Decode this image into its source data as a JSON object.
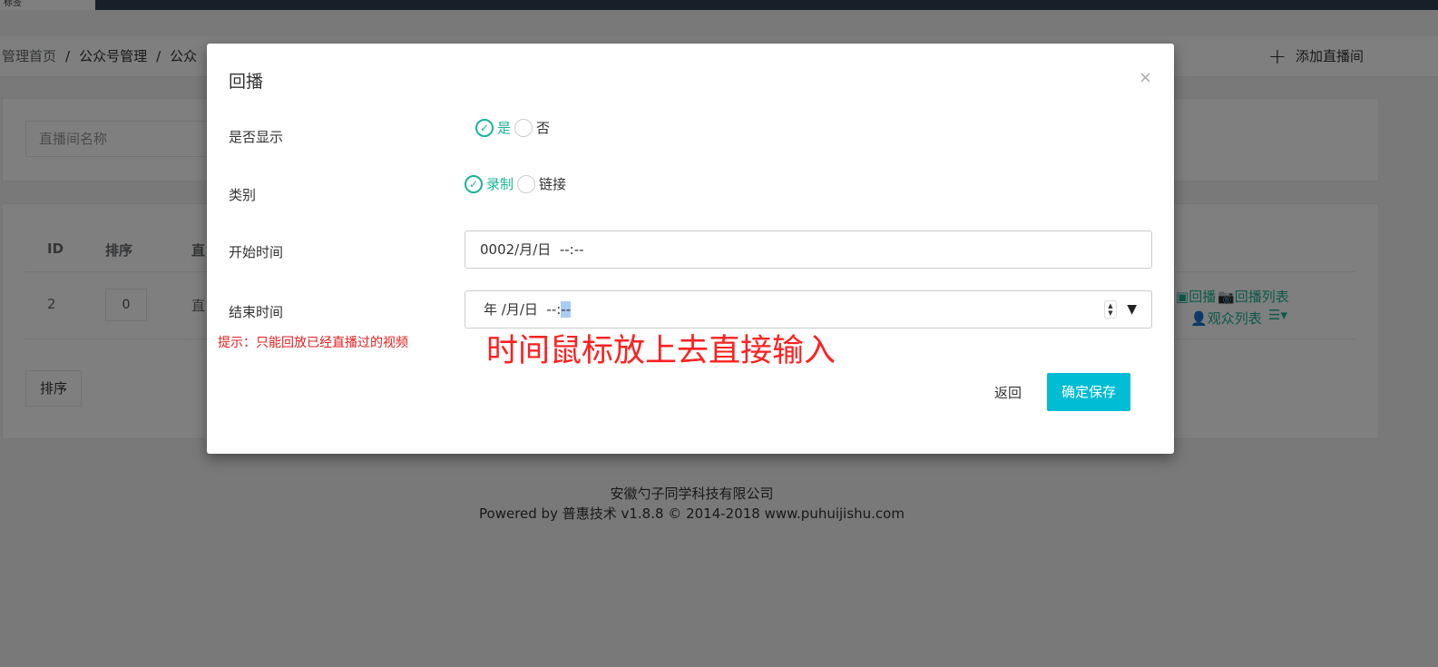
{
  "topbar": {
    "tab_label": "标签"
  },
  "breadcrumb": {
    "items": [
      "管理首页",
      "公众号管理",
      "公众"
    ]
  },
  "header": {
    "add_button_label": "添加直播间",
    "add_icon": "plus-icon"
  },
  "search": {
    "placeholder": "直播间名称"
  },
  "table": {
    "headers": [
      "ID",
      "排序",
      "直"
    ],
    "rows": [
      {
        "id": "2",
        "sort": "0",
        "name": "直",
        "actions": [
          "回播",
          "回播列表",
          "观众列表"
        ]
      }
    ]
  },
  "sort_button_label": "排序",
  "footer": {
    "company": "安徽勺子同学科技有限公司",
    "powered": "Powered by 普惠技术 v1.8.8 © 2014-2018 www.puhuijishu.com"
  },
  "modal": {
    "title": "回播",
    "close_glyph": "×",
    "fields": {
      "display": {
        "label": "是否显示",
        "options": [
          "是",
          "否"
        ],
        "selected": "是"
      },
      "category": {
        "label": "类别",
        "options": [
          "录制",
          "链接"
        ],
        "selected": "录制"
      },
      "start_time": {
        "label": "开始时间",
        "value": "0002/月/日  --:--"
      },
      "end_time": {
        "label": "结束时间",
        "value_prefix": "年 /月/日  --:",
        "value_highlight": "--"
      }
    },
    "hint": "提示：只能回放已经直播过的视频",
    "annotation": "时间鼠标放上去直接输入",
    "back_label": "返回",
    "save_label": "确定保存"
  },
  "colors": {
    "accent": "#1ab394",
    "save_button": "#00bcd4",
    "hint": "#e02020",
    "annotation": "#ff2020",
    "topbar": "#2f4050"
  }
}
